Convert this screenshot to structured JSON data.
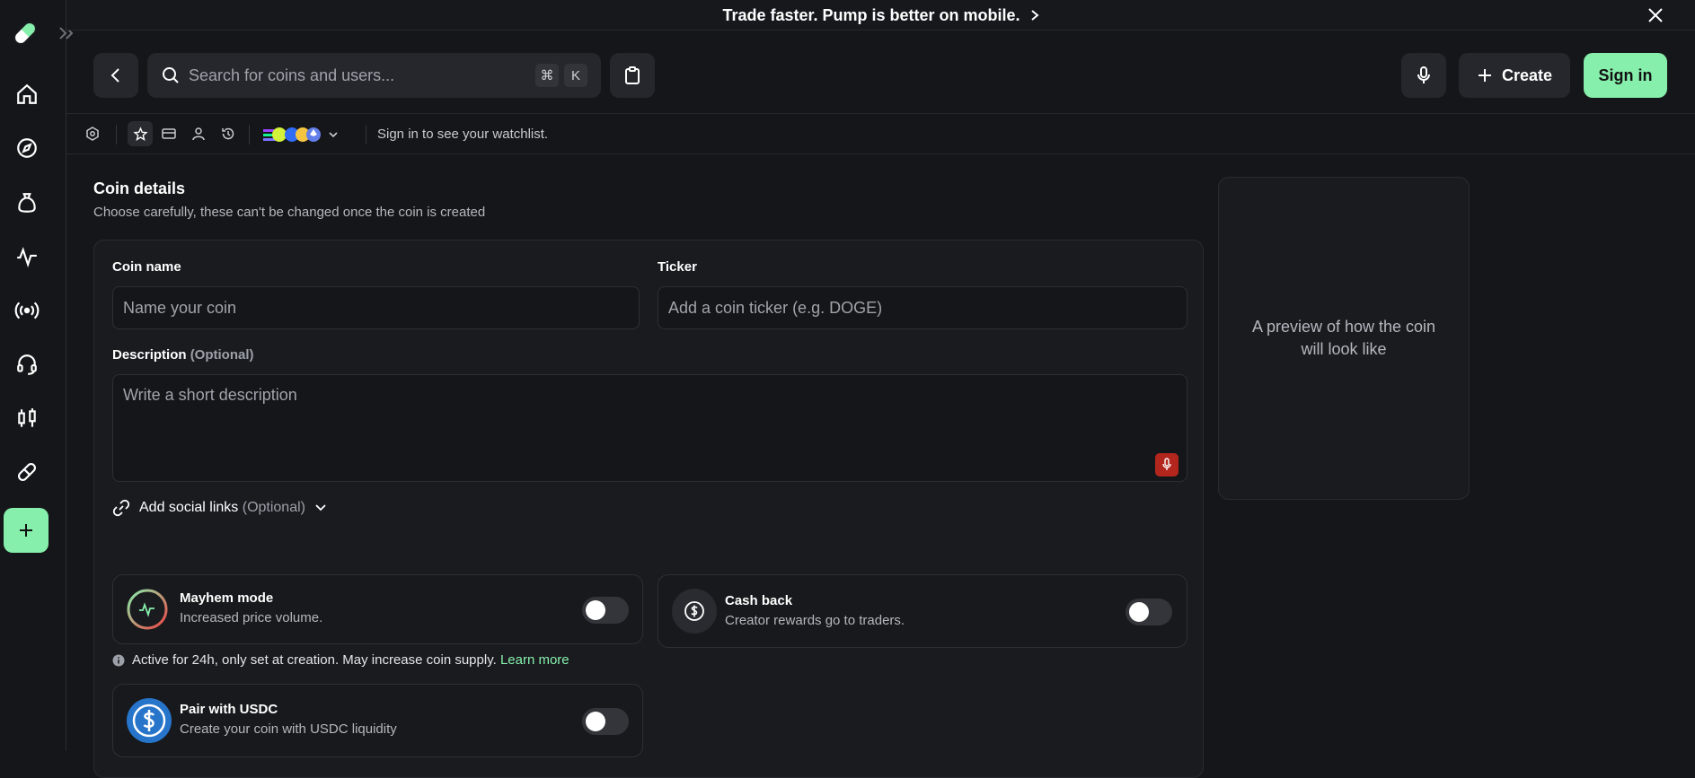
{
  "banner": {
    "text": "Trade faster. Pump is better on mobile."
  },
  "search": {
    "placeholder": "Search for coins and users...",
    "shortcut_cmd": "⌘",
    "shortcut_key": "K"
  },
  "header": {
    "create_label": "Create",
    "signin_label": "Sign in"
  },
  "subbar": {
    "watchlist_text": "Sign in to see your watchlist."
  },
  "form": {
    "title": "Coin details",
    "subtitle": "Choose carefully, these can't be changed once the coin is created",
    "name_label": "Coin name",
    "name_placeholder": "Name your coin",
    "ticker_label": "Ticker",
    "ticker_placeholder": "Add a coin ticker (e.g. DOGE)",
    "description_label": "Description",
    "description_optional": "(Optional)",
    "description_placeholder": "Write a short description",
    "social_label": "Add social links",
    "social_optional": "(Optional)"
  },
  "options": {
    "mayhem": {
      "title": "Mayhem mode",
      "desc": "Increased price volume.",
      "enabled": false
    },
    "cashback": {
      "title": "Cash back",
      "desc": "Creator rewards go to traders.",
      "enabled": false
    },
    "usdc": {
      "title": "Pair with USDC",
      "desc": "Create your coin with USDC liquidity",
      "enabled": false
    },
    "mayhem_info": "Active for 24h, only set at creation. May increase coin supply.",
    "learn_more": "Learn more"
  },
  "preview": {
    "text": "A preview of how the coin will look like"
  },
  "colors": {
    "accent": "#86efac",
    "background": "#151619",
    "card": "#1a1b1f",
    "mic": "#b3261e"
  }
}
